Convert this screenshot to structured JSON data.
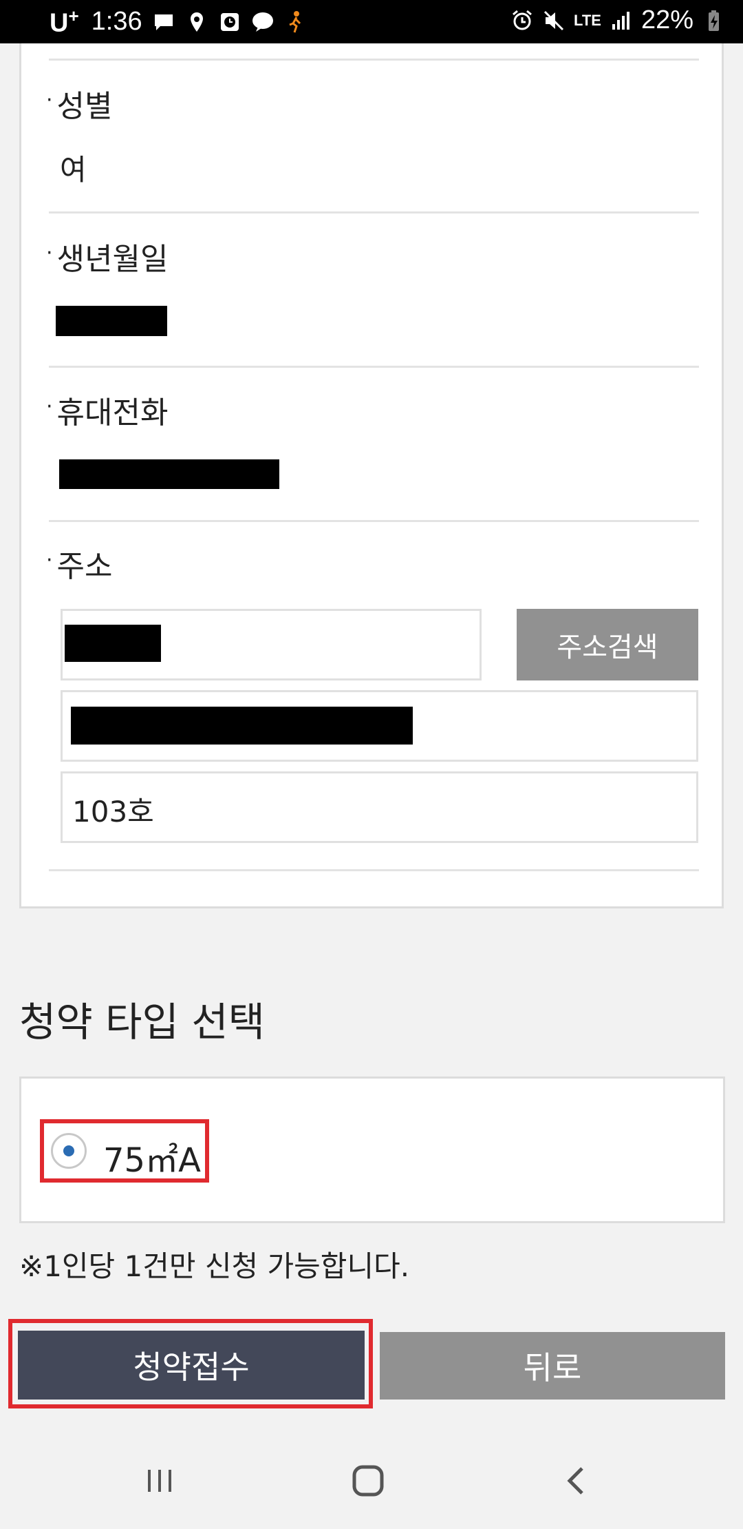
{
  "status_bar": {
    "carrier": "U",
    "carrier_sup": "+",
    "time": "1:36",
    "network": "LTE",
    "battery": "22%"
  },
  "form": {
    "gender": {
      "label": "성별",
      "value": "여"
    },
    "birthdate": {
      "label": "생년월일"
    },
    "phone": {
      "label": "휴대전화"
    },
    "address": {
      "label": "주소",
      "search_button": "주소검색",
      "detail_value": "103호"
    }
  },
  "type_section": {
    "title": "청약 타입 선택",
    "options": [
      {
        "label": "75㎡A",
        "selected": true
      }
    ]
  },
  "notice": "※1인당 1건만 신청 가능합니다.",
  "actions": {
    "submit": "청약접수",
    "back": "뒤로"
  },
  "colors": {
    "accent": "#434859",
    "highlight": "#e02a2f",
    "radio": "#2b6cb3",
    "gray_button": "#919191"
  }
}
